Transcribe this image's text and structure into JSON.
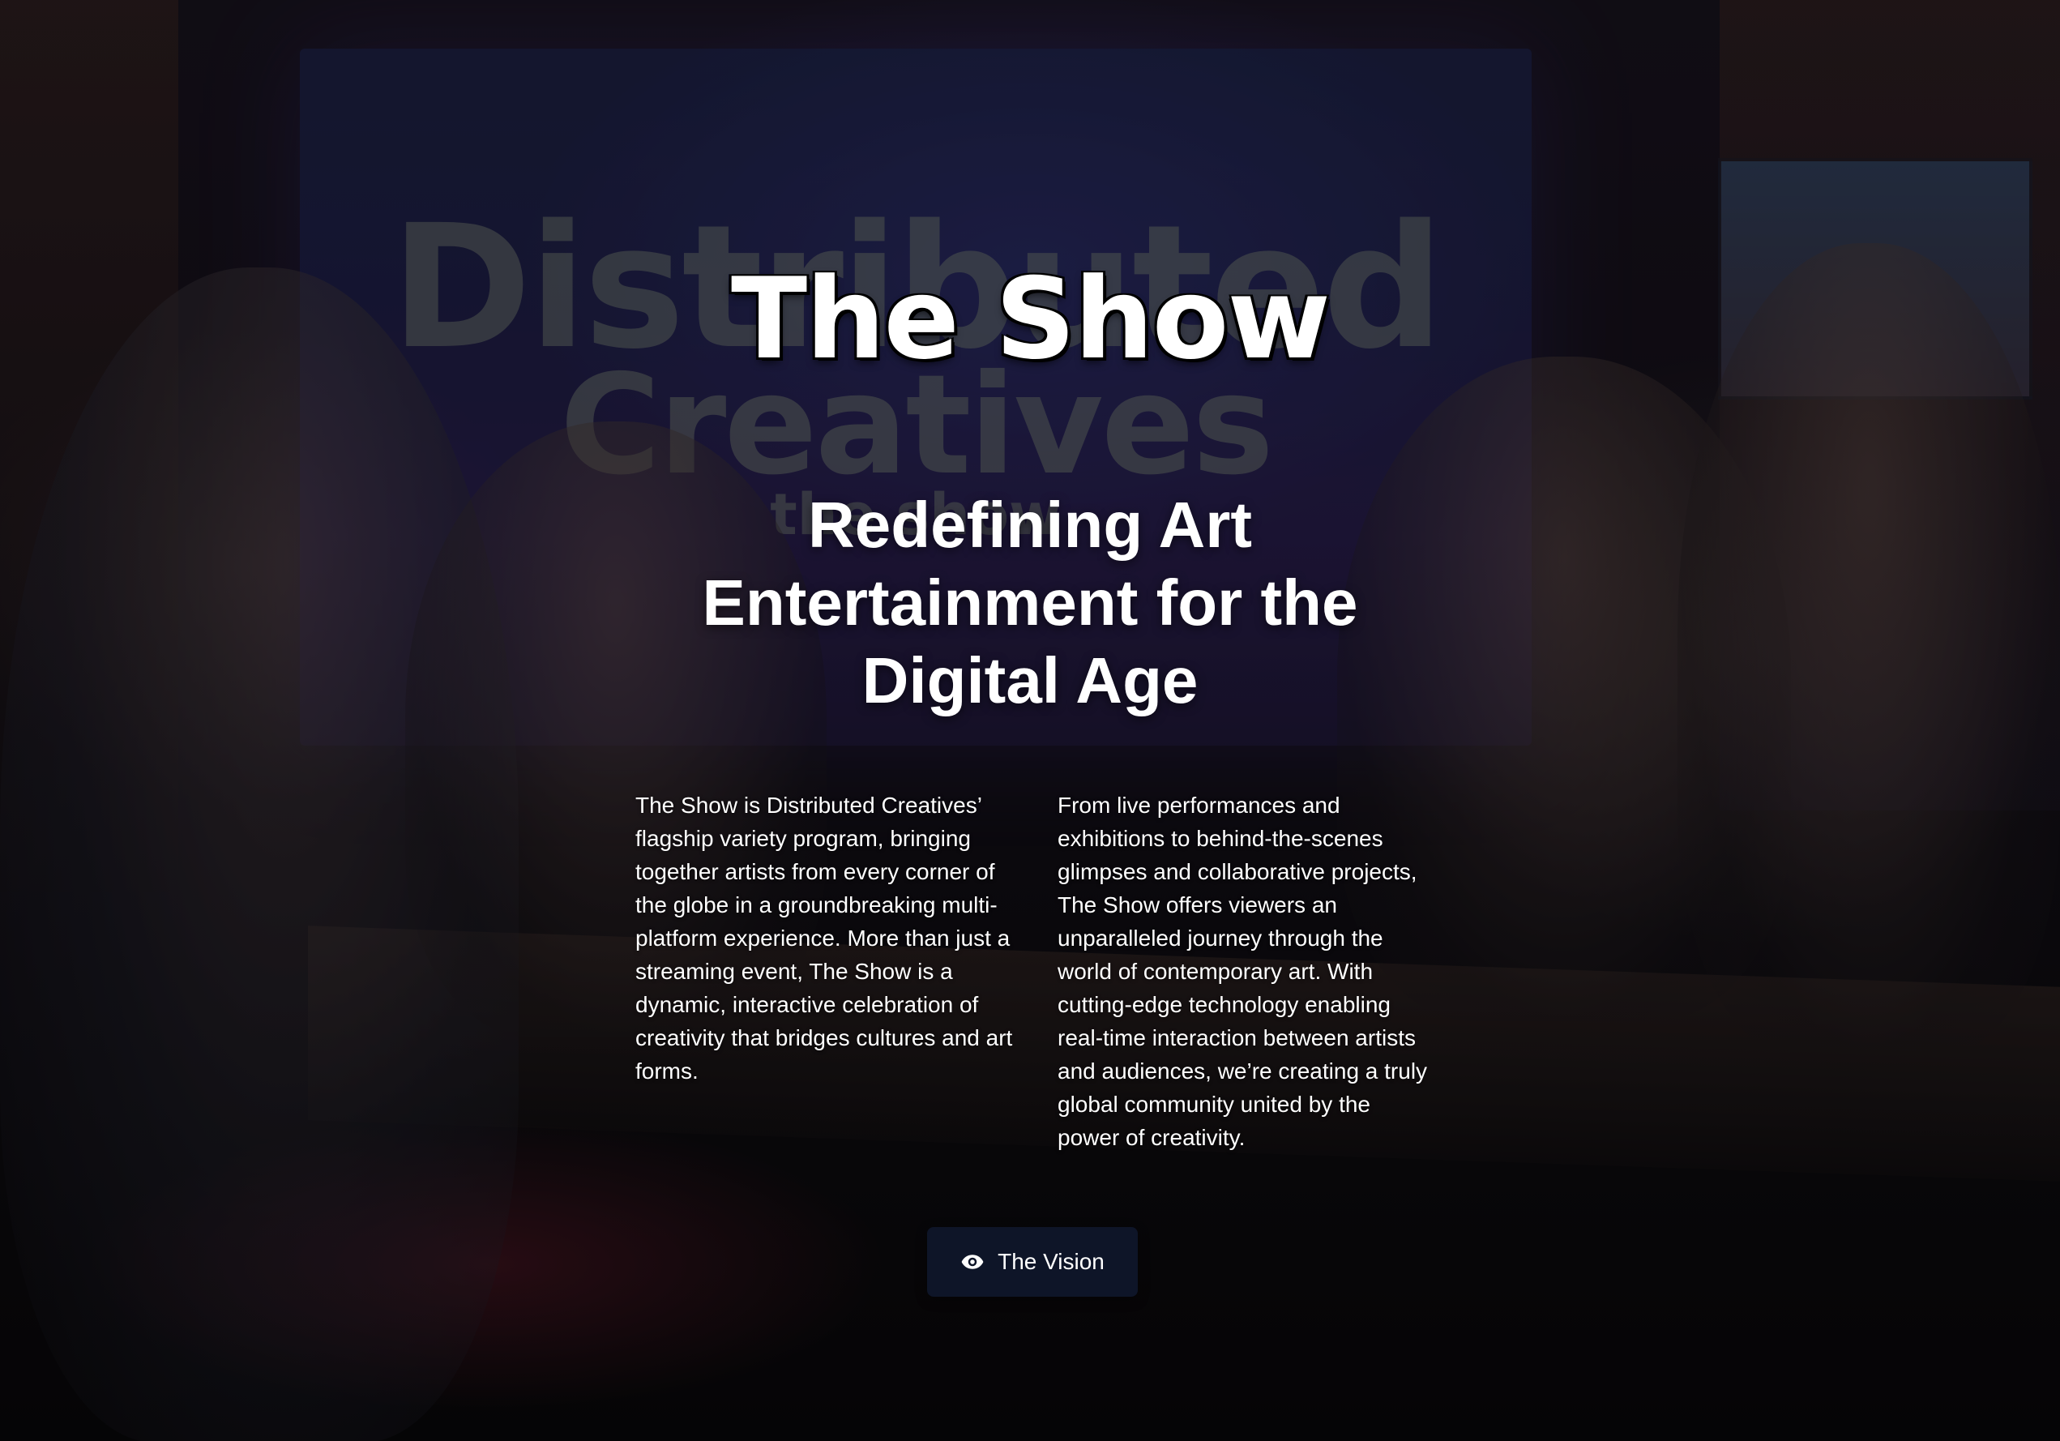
{
  "hero": {
    "title": "The Show",
    "subtitle": "Redefining Art Entertainment for the Digital Age"
  },
  "backdrop": {
    "line1": "Distributed",
    "line2": "Creatives",
    "line3": "the show"
  },
  "description": {
    "left": "The Show is Distributed Creatives’ flagship variety program, bringing together artists from every corner of the globe in a groundbreaking multi-platform experience. More than just a streaming event, The Show is a dynamic, interactive celebration of creativity that bridges cultures and art forms.",
    "right": "From live performances and exhibitions to behind-the-scenes glimpses and collaborative projects, The Show offers viewers an unparalleled journey through the world of contemporary art. With cutting-edge technology enabling real-time interaction between artists and audiences, we’re creating a truly global community united by the power of creativity."
  },
  "cta": {
    "label": "The Vision",
    "icon": "eye-icon",
    "background": "#0e1528"
  }
}
